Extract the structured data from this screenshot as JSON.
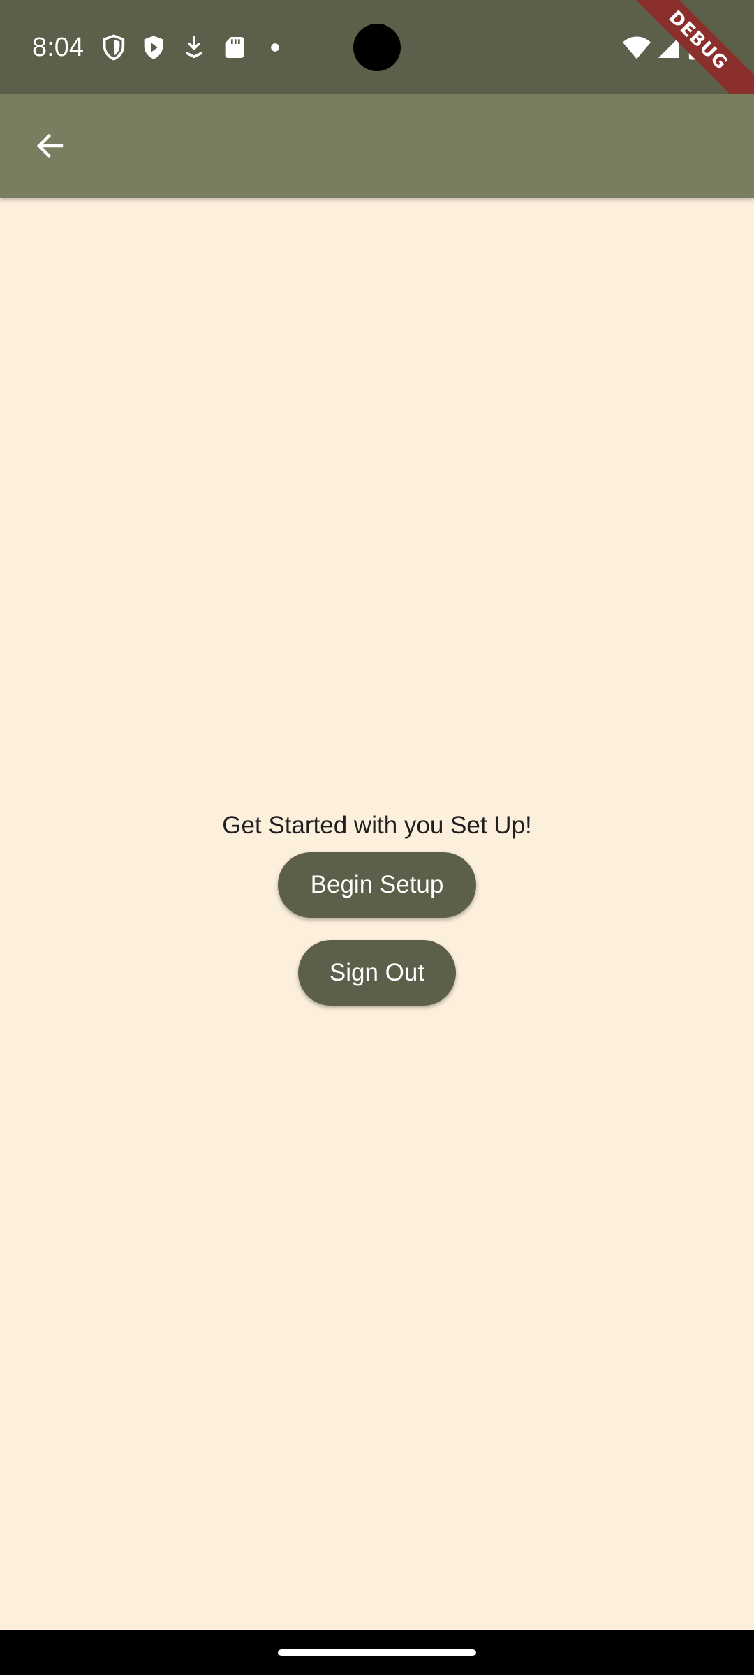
{
  "status_bar": {
    "time": "8:04",
    "icons": [
      "shield-icon",
      "play-shield-icon",
      "download-arrow-icon",
      "sd-card-icon",
      "dot-icon",
      "wifi-icon",
      "cellular-signal-icon",
      "battery-icon"
    ],
    "background_color": "#5C5F4A"
  },
  "debug_banner": {
    "label": "DEBUG",
    "color": "#8A2F2C"
  },
  "app_bar": {
    "back_icon": "arrow-back-icon",
    "background_color": "#7A7E60"
  },
  "main": {
    "prompt": "Get Started with you Set Up!",
    "begin_setup_label": "Begin Setup",
    "sign_out_label": "Sign Out",
    "background_color": "#FCEFDC",
    "button_color": "#5C5F4A"
  }
}
